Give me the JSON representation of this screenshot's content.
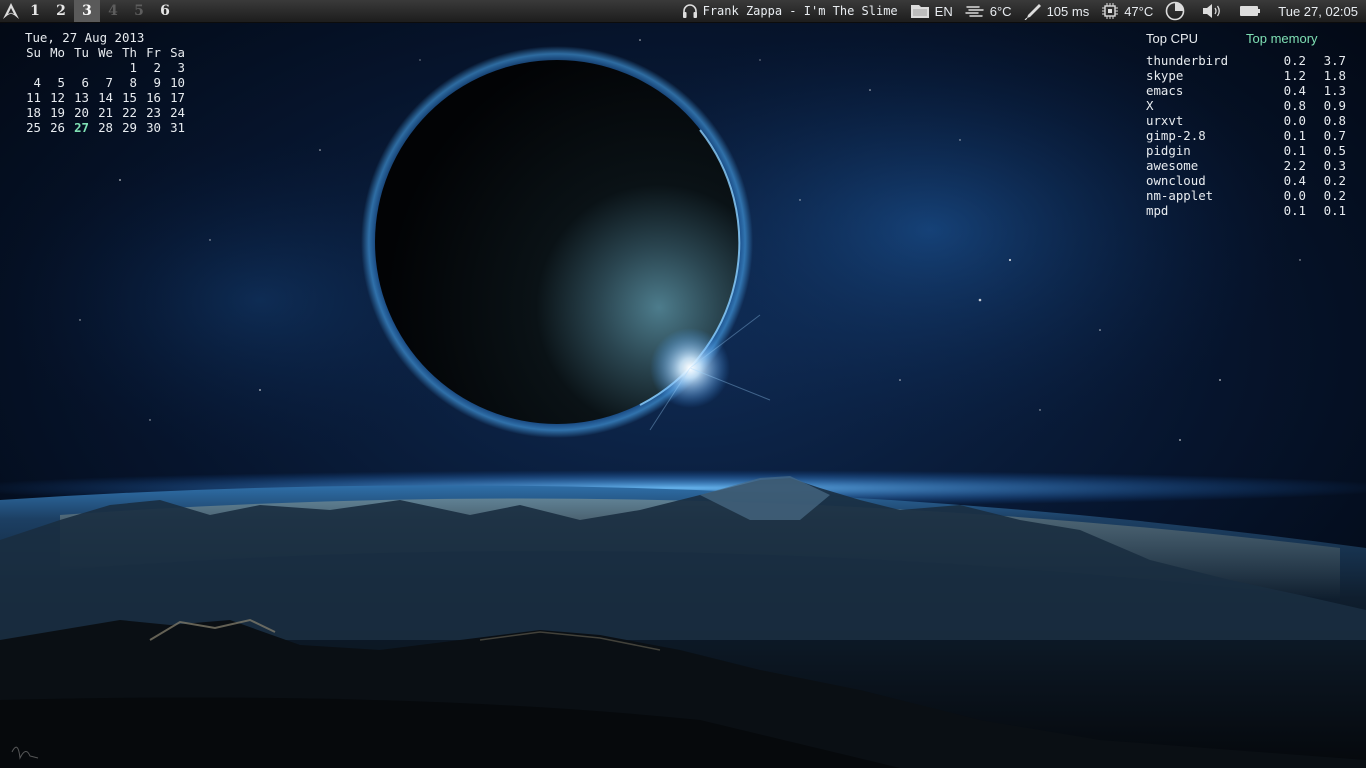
{
  "topbar": {
    "tags": [
      {
        "label": "1",
        "state": "normal"
      },
      {
        "label": "2",
        "state": "normal"
      },
      {
        "label": "3",
        "state": "active"
      },
      {
        "label": "4",
        "state": "empty"
      },
      {
        "label": "5",
        "state": "empty"
      },
      {
        "label": "6",
        "state": "normal"
      }
    ],
    "now_playing": "Frank Zappa - I'm The Slime",
    "keyboard_layout": "EN",
    "weather": "6°C",
    "ping": "105 ms",
    "cpu_temp": "47°C",
    "clock": "Tue 27, 02:05",
    "icons": {
      "launcher": "arch-logo-icon",
      "music": "headphones-icon",
      "keyboard": "keyboard-flag-icon",
      "weather": "fog-icon",
      "ping": "pen-icon",
      "cpu": "chip-icon",
      "clock_widget": "clock-icon",
      "volume": "speaker-icon",
      "battery": "battery-icon"
    }
  },
  "calendar": {
    "header": "Tue, 27 Aug 2013",
    "weekdays": [
      "Su",
      "Mo",
      "Tu",
      "We",
      "Th",
      "Fr",
      "Sa"
    ],
    "weeks": [
      [
        "",
        "",
        "",
        "",
        "1",
        "2",
        "3"
      ],
      [
        "4",
        "5",
        "6",
        "7",
        "8",
        "9",
        "10"
      ],
      [
        "11",
        "12",
        "13",
        "14",
        "15",
        "16",
        "17"
      ],
      [
        "18",
        "19",
        "20",
        "21",
        "22",
        "23",
        "24"
      ],
      [
        "25",
        "26",
        "27",
        "28",
        "29",
        "30",
        "31"
      ]
    ],
    "today": "27",
    "today_color": "#7fe0b4"
  },
  "top": {
    "cpu_heading": "Top CPU",
    "mem_heading": "Top memory",
    "accent": "#7fe0b4",
    "processes": [
      {
        "name": "thunderbird",
        "cpu": "0.2",
        "mem": "3.7"
      },
      {
        "name": "skype",
        "cpu": "1.2",
        "mem": "1.8"
      },
      {
        "name": "emacs",
        "cpu": "0.4",
        "mem": "1.3"
      },
      {
        "name": "X",
        "cpu": "0.8",
        "mem": "0.9"
      },
      {
        "name": "urxvt",
        "cpu": "0.0",
        "mem": "0.8"
      },
      {
        "name": "gimp-2.8",
        "cpu": "0.1",
        "mem": "0.7"
      },
      {
        "name": "pidgin",
        "cpu": "0.1",
        "mem": "0.5"
      },
      {
        "name": "awesome",
        "cpu": "2.2",
        "mem": "0.3"
      },
      {
        "name": "owncloud",
        "cpu": "0.4",
        "mem": "0.2"
      },
      {
        "name": "nm-applet",
        "cpu": "0.0",
        "mem": "0.2"
      },
      {
        "name": "mpd",
        "cpu": "0.1",
        "mem": "0.1"
      }
    ]
  }
}
